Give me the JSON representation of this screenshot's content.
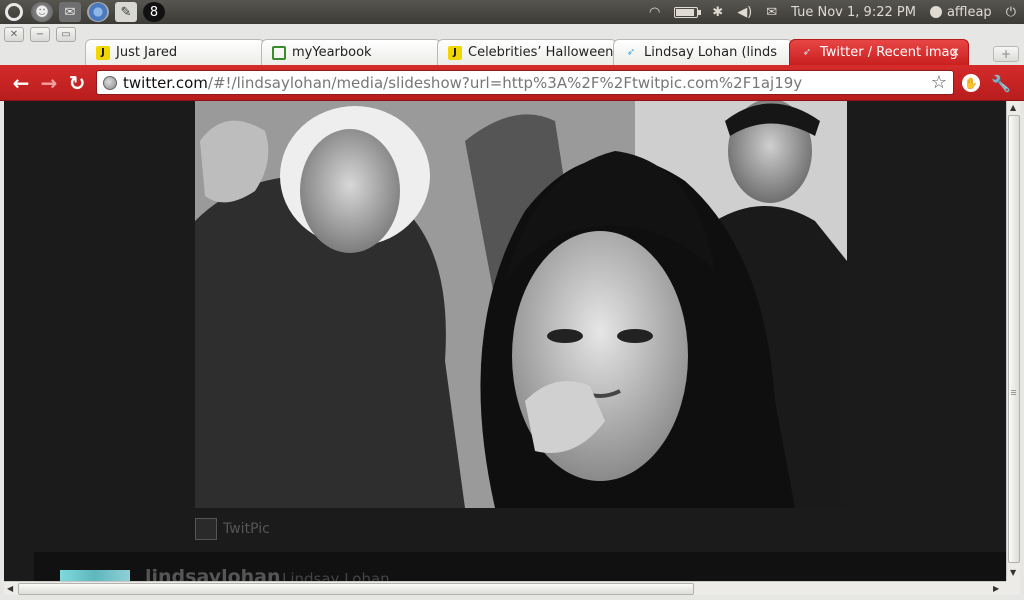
{
  "panel": {
    "clock": "Tue Nov  1,  9:22 PM",
    "user": "affleap",
    "battery_level": 0.8,
    "launchers": [
      "ubuntu-logo",
      "firefox-icon",
      "pidgin-icon",
      "chromium-icon",
      "text-editor-icon",
      "terminal-icon"
    ]
  },
  "window": {
    "tabs": [
      {
        "title": "Just Jared",
        "favicon": "justjared-icon"
      },
      {
        "title": "myYearbook",
        "favicon": "myyearbook-icon"
      },
      {
        "title": "Celebrities’ Halloween",
        "favicon": "justjared-icon"
      },
      {
        "title": "Lindsay Lohan (linds",
        "favicon": "twitter-bird-icon"
      },
      {
        "title": "Twitter / Recent imag",
        "favicon": "twitter-bird-icon",
        "active": true
      }
    ],
    "close_tab_glyph": "×",
    "new_tab_glyph": "+"
  },
  "toolbar": {
    "url_host": "twitter.com",
    "url_path": "/#!/lindsaylohan/media/slideshow?url=http%3A%2F%2Ftwitpic.com%2F1aj19y",
    "back_glyph": "←",
    "forward_glyph": "→",
    "reload_glyph": "↻",
    "bookmark_glyph": "☆",
    "wrench_glyph": "🔧"
  },
  "content": {
    "source_label": "TwitPic",
    "tweet_screen_name": "lindsaylohan",
    "tweet_full_name": "Lindsay Lohan"
  },
  "colors": {
    "theme_red": "#c91f1f",
    "page_bg": "#1b1b1b"
  }
}
